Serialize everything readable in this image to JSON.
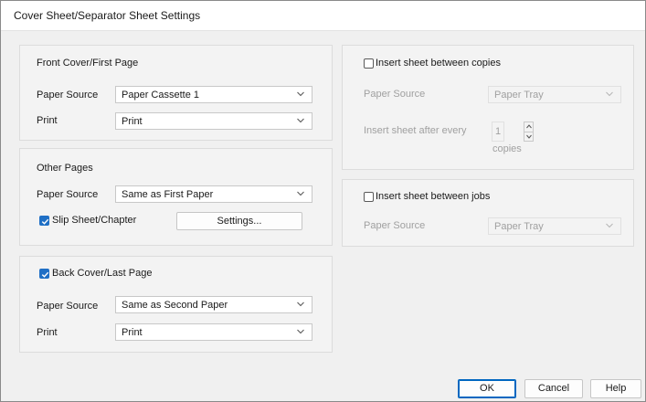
{
  "window": {
    "title": "Cover Sheet/Separator Sheet Settings"
  },
  "front_cover": {
    "group_title": "Front Cover/First Page",
    "paper_source_label": "Paper Source",
    "paper_source_value": "Paper Cassette 1",
    "print_label": "Print",
    "print_value": "Print"
  },
  "other_pages": {
    "group_title": "Other Pages",
    "paper_source_label": "Paper Source",
    "paper_source_value": "Same as First Paper",
    "slip_sheet_label": "Slip Sheet/Chapter",
    "slip_sheet_checked": true,
    "settings_button": "Settings..."
  },
  "back_cover": {
    "checkbox_label": "Back Cover/Last Page",
    "checked": true,
    "paper_source_label": "Paper Source",
    "paper_source_value": "Same as Second Paper",
    "print_label": "Print",
    "print_value": "Print"
  },
  "between_copies": {
    "checkbox_label": "Insert sheet between copies",
    "checked": false,
    "paper_source_label": "Paper Source",
    "paper_source_value": "Paper Tray",
    "after_every_label": "Insert sheet after every",
    "after_every_value": "1",
    "copies_label": "copies"
  },
  "between_jobs": {
    "checkbox_label": "Insert sheet between jobs",
    "checked": false,
    "paper_source_label": "Paper Source",
    "paper_source_value": "Paper Tray"
  },
  "footer": {
    "ok": "OK",
    "cancel": "Cancel",
    "help": "Help"
  },
  "colors": {
    "accent": "#1f6fc5",
    "disabled_text": "#a0a0a0"
  }
}
